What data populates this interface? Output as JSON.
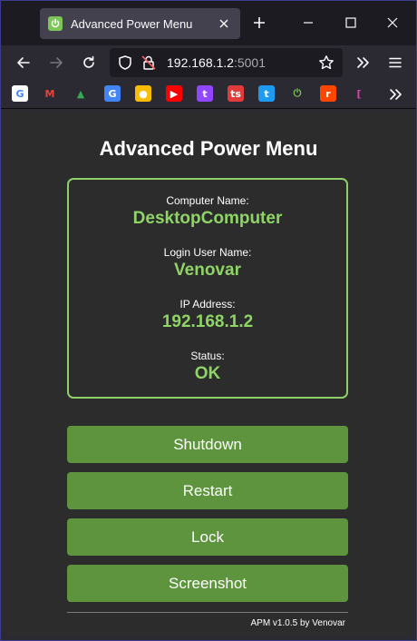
{
  "browser": {
    "tab_title": "Advanced Power Menu",
    "url_host": "192.168.1.2",
    "url_port": ":5001",
    "bookmarks": [
      {
        "icon": "google-icon",
        "glyph": "G",
        "color": "#ffffff",
        "fg": "#4285f4"
      },
      {
        "icon": "gmail-icon",
        "glyph": "M",
        "color": "#2b2a33",
        "fg": "#ea4335"
      },
      {
        "icon": "drive-icon",
        "glyph": "▲",
        "color": "#2b2a33",
        "fg": "#34a853"
      },
      {
        "icon": "translate-icon",
        "glyph": "G",
        "color": "#4285f4",
        "fg": "#ffffff"
      },
      {
        "icon": "keep-icon",
        "glyph": "●",
        "color": "#fbbc04",
        "fg": "#ffffff"
      },
      {
        "icon": "youtube-icon",
        "glyph": "▶",
        "color": "#ff0000",
        "fg": "#ffffff"
      },
      {
        "icon": "twitch-icon",
        "glyph": "t",
        "color": "#9146ff",
        "fg": "#ffffff"
      },
      {
        "icon": "ts-icon",
        "glyph": "ts",
        "color": "#e23b3b",
        "fg": "#ffffff"
      },
      {
        "icon": "twitter-icon",
        "glyph": "t",
        "color": "#1d9bf0",
        "fg": "#ffffff"
      },
      {
        "icon": "power-icon",
        "glyph": "⏻",
        "color": "#2b2a33",
        "fg": "#7cc557"
      },
      {
        "icon": "reddit-icon",
        "glyph": "r",
        "color": "#ff4500",
        "fg": "#ffffff"
      },
      {
        "icon": "bracket-icon",
        "glyph": "[",
        "color": "#2b2a33",
        "fg": "#e23bb5"
      }
    ]
  },
  "page": {
    "title": "Advanced Power Menu",
    "info": {
      "computer_name_label": "Computer Name:",
      "computer_name": "DesktopComputer",
      "login_user_label": "Login User Name:",
      "login_user": "Venovar",
      "ip_label": "IP Address:",
      "ip": "192.168.1.2",
      "status_label": "Status:",
      "status": "OK"
    },
    "buttons": {
      "shutdown": "Shutdown",
      "restart": "Restart",
      "lock": "Lock",
      "screenshot": "Screenshot"
    },
    "footer": "APM v1.0.5 by Venovar"
  },
  "colors": {
    "accent_green": "#8fd466",
    "button_green": "#5e943d",
    "page_bg": "#2c2c2c"
  }
}
